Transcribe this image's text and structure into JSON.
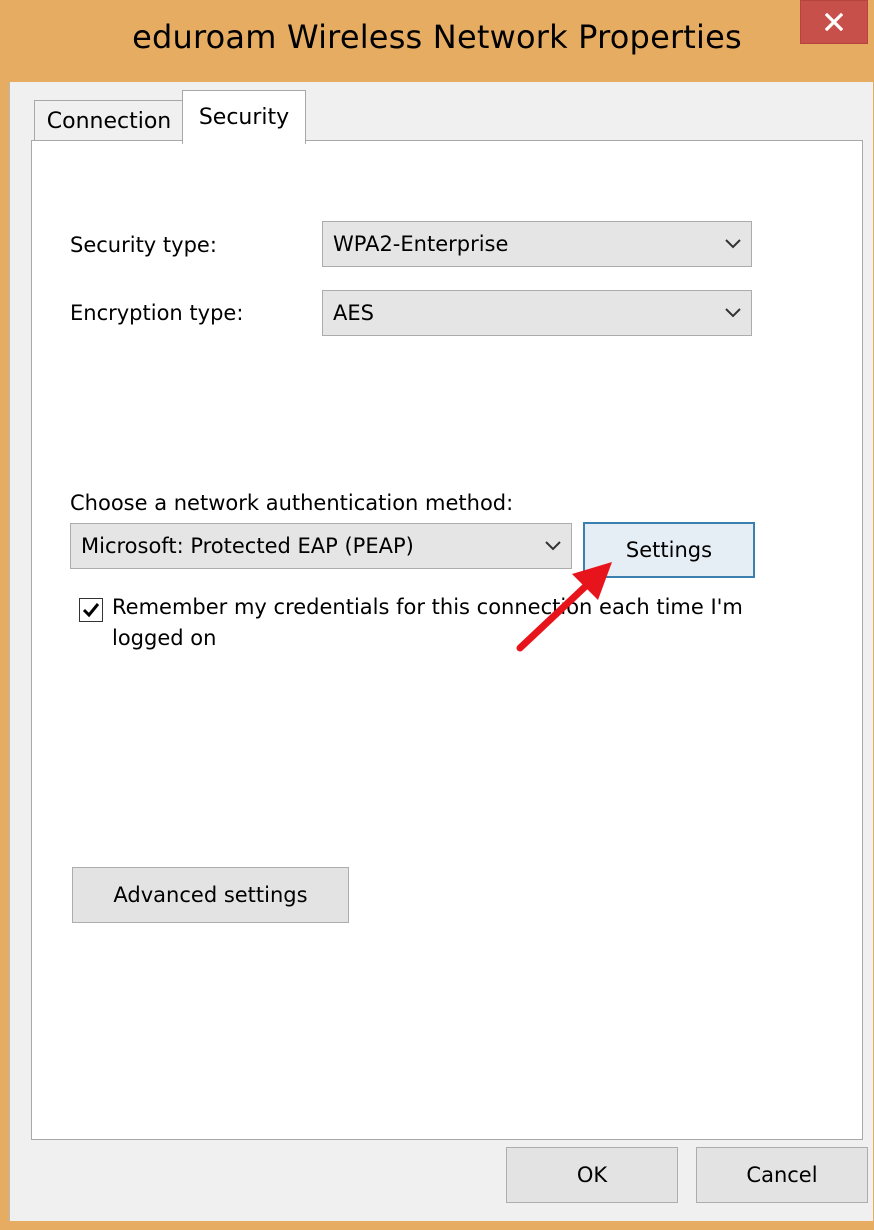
{
  "window": {
    "title": "eduroam Wireless Network Properties",
    "close_icon": "close-icon"
  },
  "tabs": [
    {
      "label": "Connection",
      "selected": false
    },
    {
      "label": "Security",
      "selected": true
    }
  ],
  "security": {
    "security_type_label": "Security type:",
    "security_type_value": "WPA2-Enterprise",
    "encryption_type_label": "Encryption type:",
    "encryption_type_value": "AES",
    "auth_method_label": "Choose a network authentication method:",
    "auth_method_value": "Microsoft: Protected EAP (PEAP)",
    "settings_button": "Settings",
    "remember_checked": true,
    "remember_label": "Remember my credentials for this connection each time I'm logged on",
    "advanced_button": "Advanced settings"
  },
  "footer": {
    "ok_button": "OK",
    "cancel_button": "Cancel"
  },
  "annotation": {
    "arrow_color": "#e8141b",
    "icon": "red-arrow-icon"
  }
}
